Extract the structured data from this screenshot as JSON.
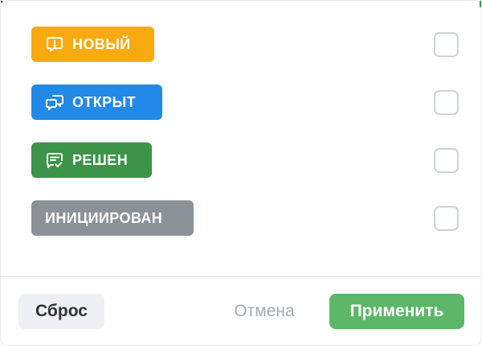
{
  "statuses": [
    {
      "label": "НОВЫЙ",
      "icon": "alert-message-icon",
      "color": "#f8aa10",
      "checked": false
    },
    {
      "label": "ОТКРЫТ",
      "icon": "chat-bubbles-icon",
      "color": "#2289e6",
      "checked": false
    },
    {
      "label": "РЕШЕН",
      "icon": "message-check-icon",
      "color": "#3b9447",
      "checked": false
    },
    {
      "label": "ИНИЦИИРОВАН",
      "icon": "",
      "color": "#8a9199",
      "checked": false
    }
  ],
  "footer": {
    "reset_label": "Сброс",
    "cancel_label": "Отмена",
    "apply_label": "Применить"
  }
}
